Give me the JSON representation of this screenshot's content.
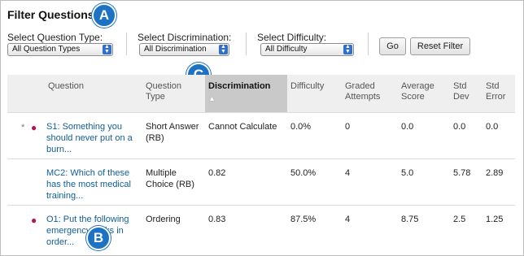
{
  "page": {
    "title": "Filter Questions"
  },
  "callouts": {
    "a": "A",
    "b": "B",
    "c": "C"
  },
  "filters": {
    "type": {
      "label": "Select Question Type:",
      "value": "All Question Types"
    },
    "discrimination": {
      "label": "Select Discrimination:",
      "value": "All Discrimination"
    },
    "difficulty": {
      "label": "Select Difficulty:",
      "value": "All Difficulty"
    },
    "go_label": "Go",
    "reset_label": "Reset Filter"
  },
  "table": {
    "headers": {
      "question": "Question",
      "type": "Question Type",
      "discrimination": "Discrimination",
      "difficulty": "Difficulty",
      "graded": "Graded Attempts",
      "avg": "Average Score",
      "std_dev": "Std Dev",
      "std_err": "Std Error"
    },
    "sort_indicator": "▲",
    "rows": [
      {
        "star": "*",
        "dot": "●",
        "question": "S1: Something you should never put on a burn...",
        "type": "Short Answer (RB)",
        "discrimination": "Cannot Calculate",
        "difficulty": "0.0%",
        "graded": "0",
        "avg": "0.0",
        "std_dev": "0.0",
        "std_err": "0.0"
      },
      {
        "question": "MC2: Which of these has the most medical training...",
        "type": "Multiple Choice (RB)",
        "discrimination": "0.82",
        "difficulty": "50.0%",
        "graded": "4",
        "avg": "5.0",
        "std_dev": "5.78",
        "std_err": "2.89"
      },
      {
        "dot": "●",
        "question": "O1: Put the following emergency tasks in order...",
        "type": "Ordering",
        "discrimination": "0.83",
        "difficulty": "87.5%",
        "graded": "4",
        "avg": "8.75",
        "std_dev": "2.5",
        "std_err": "1.25"
      }
    ]
  }
}
